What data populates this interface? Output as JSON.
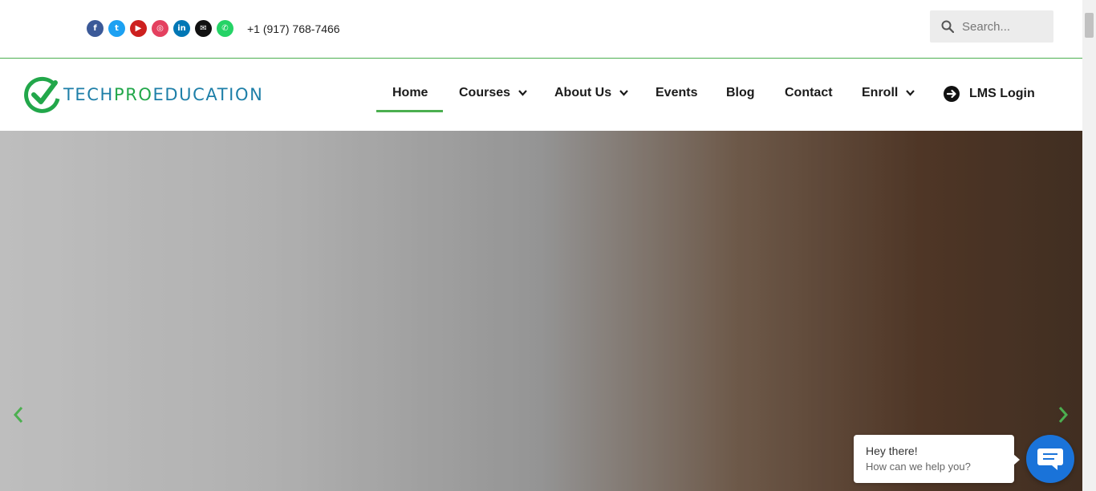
{
  "topbar": {
    "socials": [
      {
        "name": "facebook-icon",
        "glyph": "f",
        "color": "#3b5998"
      },
      {
        "name": "twitter-icon",
        "glyph": "t",
        "color": "#1da1f2"
      },
      {
        "name": "youtube-icon",
        "glyph": "▶",
        "color": "#cd201f"
      },
      {
        "name": "instagram-icon",
        "glyph": "◎",
        "color": "#e4405f"
      },
      {
        "name": "linkedin-icon",
        "glyph": "in",
        "color": "#0077b5"
      },
      {
        "name": "email-icon",
        "glyph": "✉",
        "color": "#111111"
      },
      {
        "name": "whatsapp-icon",
        "glyph": "✆",
        "color": "#25d366"
      }
    ],
    "phone": "+1 (917) 768-7466",
    "search_placeholder": "Search..."
  },
  "logo": {
    "part1": "TECH",
    "part2": "PRO",
    "part3": "EDUCATION"
  },
  "nav": {
    "home": "Home",
    "courses": "Courses",
    "about": "About Us",
    "events": "Events",
    "blog": "Blog",
    "contact": "Contact",
    "enroll": "Enroll",
    "lms": "LMS Login"
  },
  "chat": {
    "greeting": "Hey there!",
    "prompt": "How can we help you?"
  },
  "colors": {
    "accent": "#4caf50",
    "brand_blue": "#1e7fa8",
    "chat_blue": "#1a73d9"
  }
}
